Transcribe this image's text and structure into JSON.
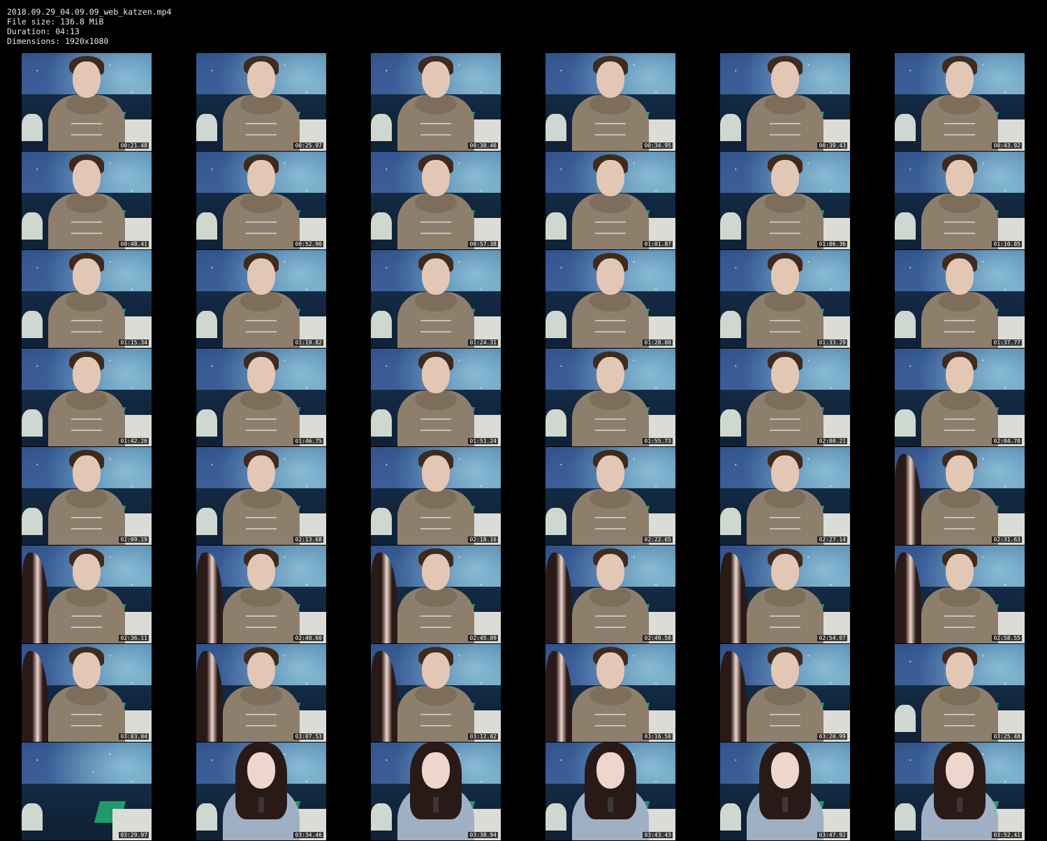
{
  "info": {
    "filename": "2018.09.29_04.09.09_web_katzen.mp4",
    "filesize": "File size: 136.8 MiB",
    "duration": "Duration: 04:13",
    "dimensions": "Dimensions: 1920x1080"
  },
  "thumbnails": [
    {
      "ts": "00:21.48",
      "scene": "boy"
    },
    {
      "ts": "00:25.97",
      "scene": "boy"
    },
    {
      "ts": "00:30.46",
      "scene": "boy"
    },
    {
      "ts": "00:34.95",
      "scene": "boy"
    },
    {
      "ts": "00:39.43",
      "scene": "boy"
    },
    {
      "ts": "00:43.92",
      "scene": "boy"
    },
    {
      "ts": "00:48.41",
      "scene": "boy"
    },
    {
      "ts": "00:52.90",
      "scene": "boy"
    },
    {
      "ts": "00:57.38",
      "scene": "boy"
    },
    {
      "ts": "01:01.87",
      "scene": "boy"
    },
    {
      "ts": "01:06.36",
      "scene": "boy"
    },
    {
      "ts": "01:10.85",
      "scene": "boy"
    },
    {
      "ts": "01:15.34",
      "scene": "boy"
    },
    {
      "ts": "01:19.82",
      "scene": "boy"
    },
    {
      "ts": "01:24.31",
      "scene": "boy"
    },
    {
      "ts": "01:28.80",
      "scene": "boy"
    },
    {
      "ts": "01:33.29",
      "scene": "boy"
    },
    {
      "ts": "01:37.77",
      "scene": "boy"
    },
    {
      "ts": "01:42.26",
      "scene": "boy"
    },
    {
      "ts": "01:46.75",
      "scene": "boy"
    },
    {
      "ts": "01:51.24",
      "scene": "boy"
    },
    {
      "ts": "01:55.73",
      "scene": "boy"
    },
    {
      "ts": "02:00.21",
      "scene": "boy"
    },
    {
      "ts": "02:04.70",
      "scene": "boy"
    },
    {
      "ts": "02:09.19",
      "scene": "boy"
    },
    {
      "ts": "02:13.68",
      "scene": "boy"
    },
    {
      "ts": "02:18.16",
      "scene": "boy"
    },
    {
      "ts": "02:22.65",
      "scene": "boy"
    },
    {
      "ts": "02:27.14",
      "scene": "boy"
    },
    {
      "ts": "02:31.63",
      "scene": "pair"
    },
    {
      "ts": "02:36.11",
      "scene": "pair"
    },
    {
      "ts": "02:40.60",
      "scene": "pair"
    },
    {
      "ts": "02:45.09",
      "scene": "pair"
    },
    {
      "ts": "02:49.58",
      "scene": "pair"
    },
    {
      "ts": "02:54.07",
      "scene": "pair"
    },
    {
      "ts": "02:58.55",
      "scene": "pair"
    },
    {
      "ts": "03:03.04",
      "scene": "pair"
    },
    {
      "ts": "03:07.53",
      "scene": "pair"
    },
    {
      "ts": "03:12.02",
      "scene": "pair"
    },
    {
      "ts": "03:16.50",
      "scene": "pair"
    },
    {
      "ts": "03:20.99",
      "scene": "pair"
    },
    {
      "ts": "03:25.48",
      "scene": "boy"
    },
    {
      "ts": "03:29.97",
      "scene": "empty"
    },
    {
      "ts": "03:34.46",
      "scene": "girl"
    },
    {
      "ts": "03:38.94",
      "scene": "girl"
    },
    {
      "ts": "03:43.43",
      "scene": "girl"
    },
    {
      "ts": "03:47.92",
      "scene": "girl"
    },
    {
      "ts": "03:52.41",
      "scene": "girl"
    }
  ]
}
